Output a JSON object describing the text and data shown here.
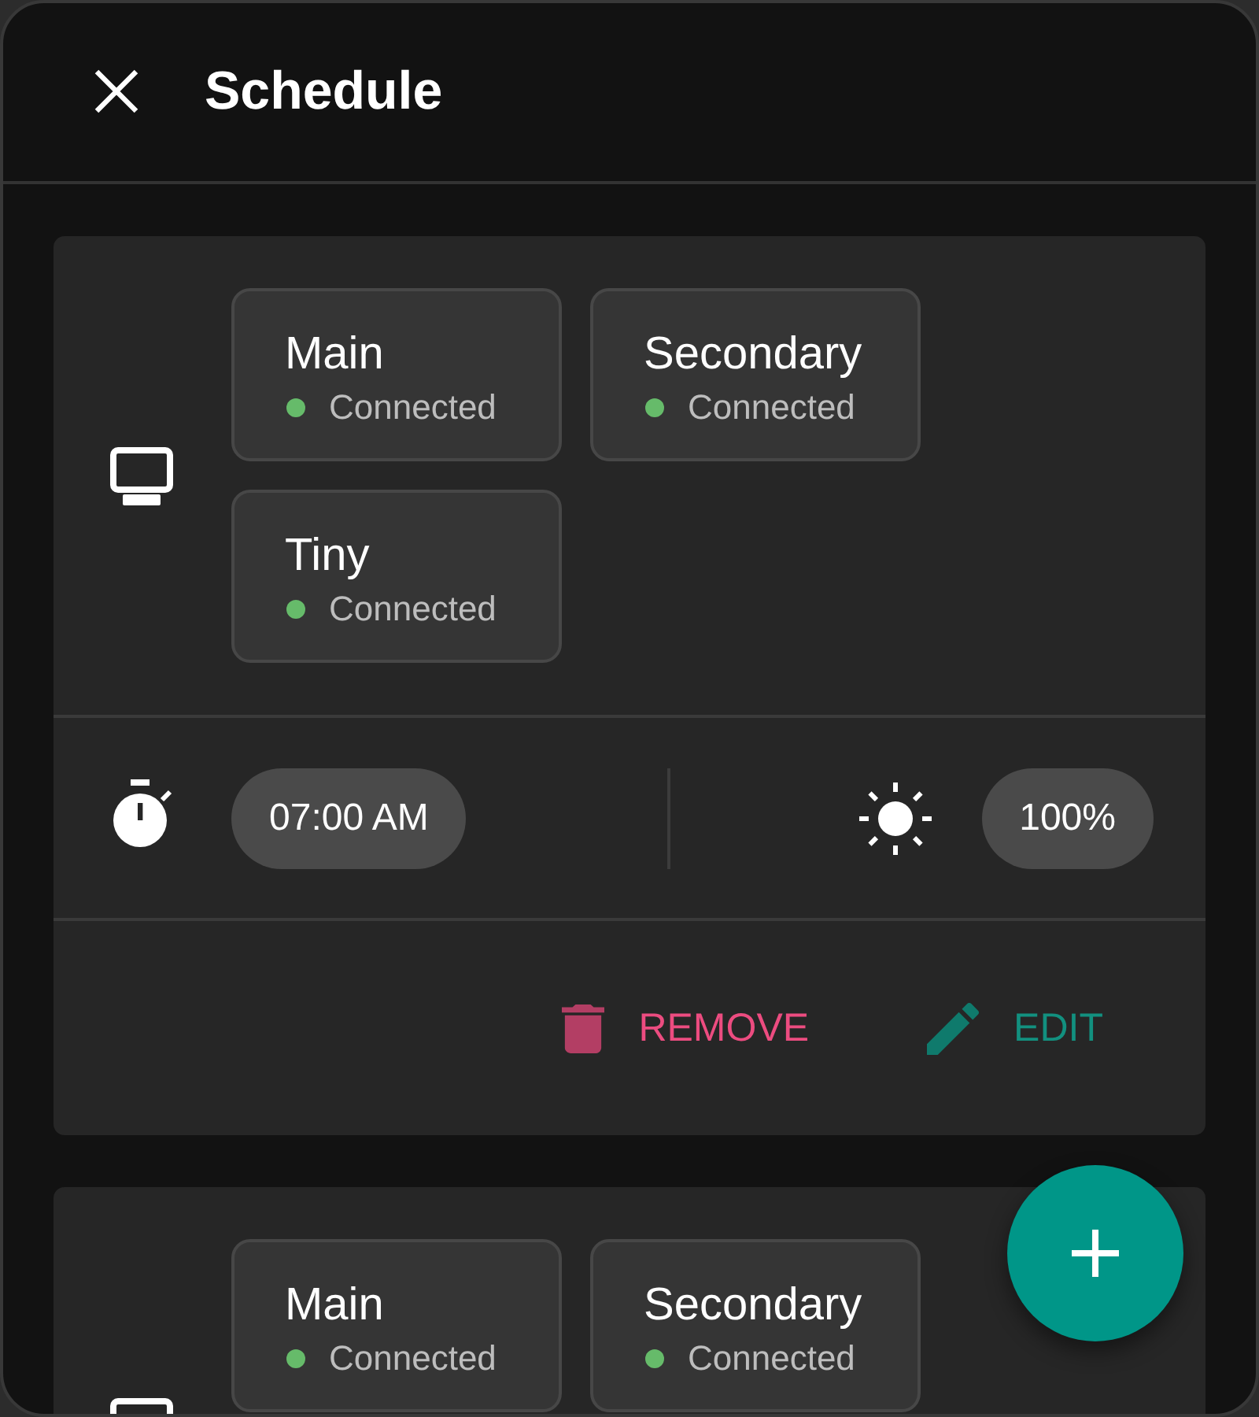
{
  "header": {
    "title": "Schedule"
  },
  "schedules": [
    {
      "devices": [
        {
          "name": "Main",
          "status": "Connected",
          "color": "#66bb6a"
        },
        {
          "name": "Secondary",
          "status": "Connected",
          "color": "#66bb6a"
        },
        {
          "name": "Tiny",
          "status": "Connected",
          "color": "#66bb6a"
        }
      ],
      "time": "07:00 AM",
      "brightness": "100%",
      "actions": [
        {
          "kind": "remove",
          "label": "REMOVE"
        },
        {
          "kind": "edit",
          "label": "EDIT"
        }
      ]
    },
    {
      "devices": [
        {
          "name": "Main",
          "status": "Connected",
          "color": "#66bb6a"
        },
        {
          "name": "Secondary",
          "status": "Connected",
          "color": "#66bb6a"
        }
      ]
    }
  ]
}
